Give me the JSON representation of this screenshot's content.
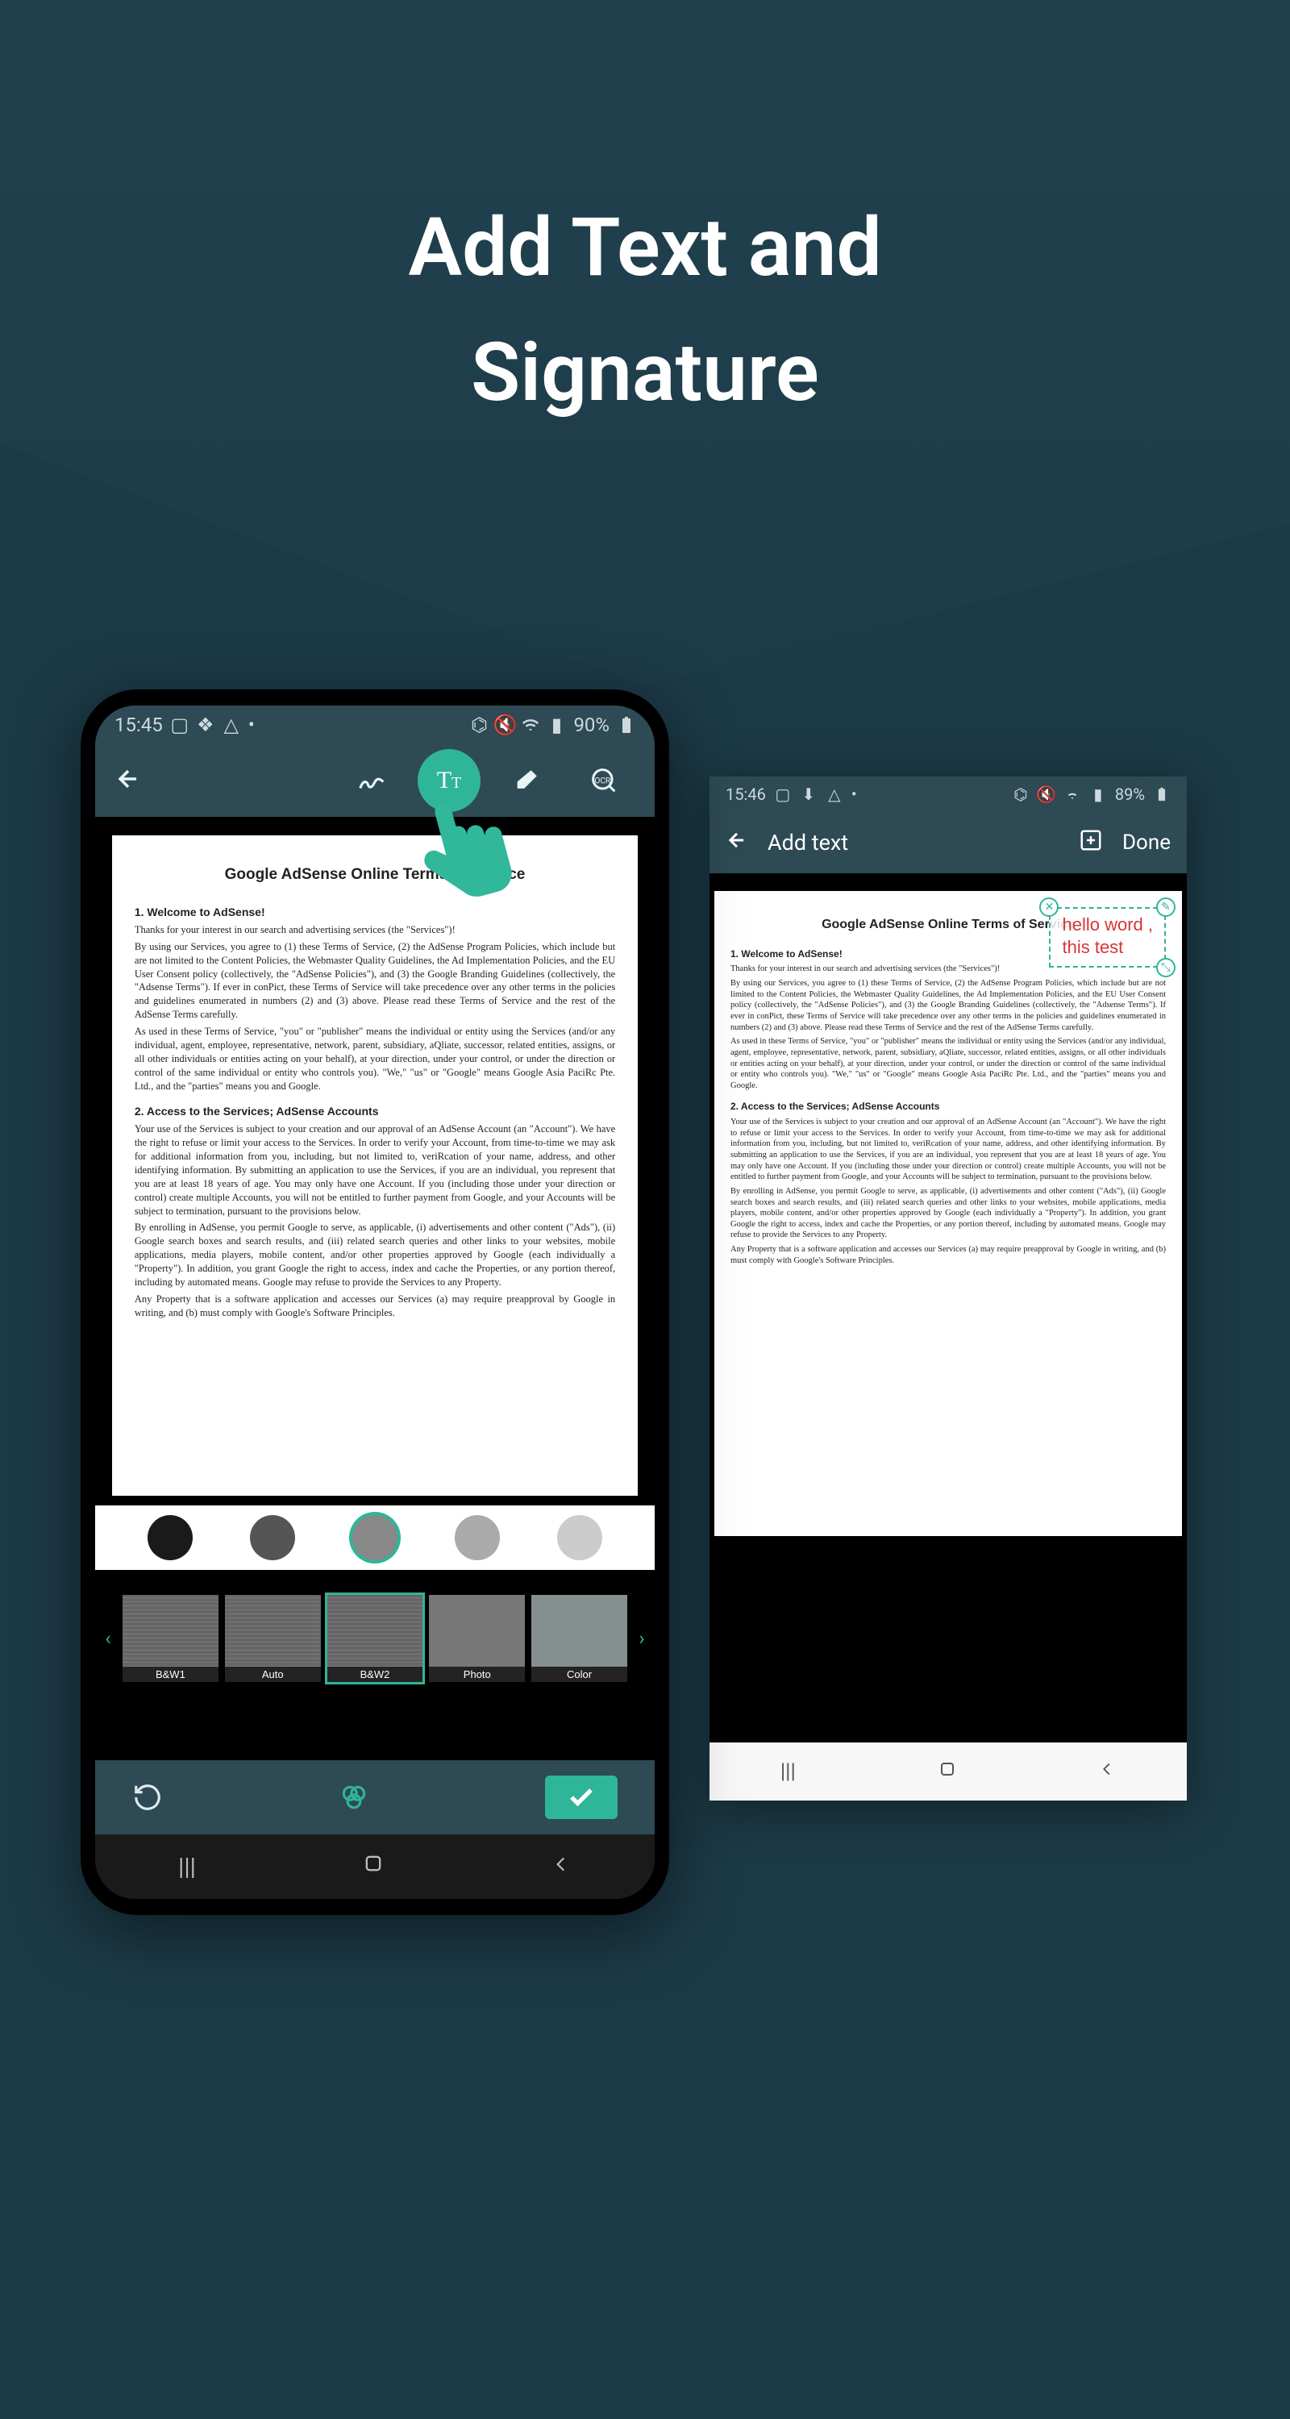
{
  "hero": {
    "line1": "Add Text and",
    "line2": "Signature"
  },
  "phone1": {
    "status": {
      "time": "15:45",
      "battery": "90%"
    },
    "document": {
      "title": "Google AdSense Online Terms of Service",
      "s1_header": "1.  Welcome to AdSense!",
      "s1_p1": "Thanks for your interest in our search and advertising services (the \"Services\")!",
      "s1_p2": "By using our Services, you agree to (1) these Terms of Service, (2) the AdSense Program Policies, which include but are not limited to the Content Policies, the Webmaster Quality Guidelines, the Ad Implementation Policies, and the EU User Consent policy (collectively, the \"AdSense Policies\"), and (3) the Google Branding Guidelines (collectively, the \"Adsense Terms\"). If ever in conPict, these Terms of Service will take precedence over any other terms in the policies and guidelines enumerated in numbers (2) and (3) above. Please read these Terms of Service and the rest of the AdSense Terms carefully.",
      "s1_p3": "As used in these Terms of Service, \"you\" or \"publisher\" means the individual or entity using the Services (and/or any individual, agent, employee, representative, network, parent, subsidiary, aQliate, successor, related entities, assigns, or all other individuals or entities acting on your behalf), at your direction, under your control, or under the direction or control of the same individual or entity who controls you). \"We,\" \"us\" or \"Google\" means Google Asia PaciRc Pte. Ltd., and the \"parties\" means you and Google.",
      "s2_header": "2. Access to the Services; AdSense Accounts",
      "s2_p1": "Your use of the Services is subject to your creation and our approval of an AdSense Account (an \"Account\"). We have the right to refuse or limit your access to the Services. In order to verify your Account, from time-to-time we may ask for additional information from you, including, but not limited to, veriRcation of your name, address, and other identifying information. By submitting an application to use the Services, if you are an individual, you represent that you are at least 18 years of age. You may only have one Account. If you (including those under your direction or control) create multiple Accounts, you will not be entitled to further payment from Google, and your Accounts will be subject to termination, pursuant to the provisions below.",
      "s2_p2": "By enrolling in AdSense, you permit Google to serve, as applicable, (i) advertisements and other content (\"Ads\"), (ii) Google search boxes and search results, and (iii) related search queries and other links to your websites, mobile applications, media players, mobile content, and/or other properties approved by Google (each individually a \"Property\"). In addition, you grant Google the right to access, index and cache the Properties, or any portion thereof, including by automated means. Google may refuse to provide the Services to any Property.",
      "s2_p3": "Any Property that is a software application and accesses our Services (a) may require preapproval by Google in writing, and (b) must comply with Google's Software Principles."
    },
    "colors": [
      "#1a1a1a",
      "#555555",
      "#888888",
      "#aaaaaa",
      "#cccccc"
    ],
    "color_selected_index": 2,
    "filters": [
      "B&W1",
      "Auto",
      "B&W2",
      "Photo",
      "Color"
    ],
    "filter_selected_index": 2
  },
  "phone2": {
    "status": {
      "time": "15:46",
      "battery": "89%"
    },
    "title": "Add text",
    "done_label": "Done",
    "annotation": {
      "line1": "hello word ,",
      "line2": "this test"
    }
  }
}
